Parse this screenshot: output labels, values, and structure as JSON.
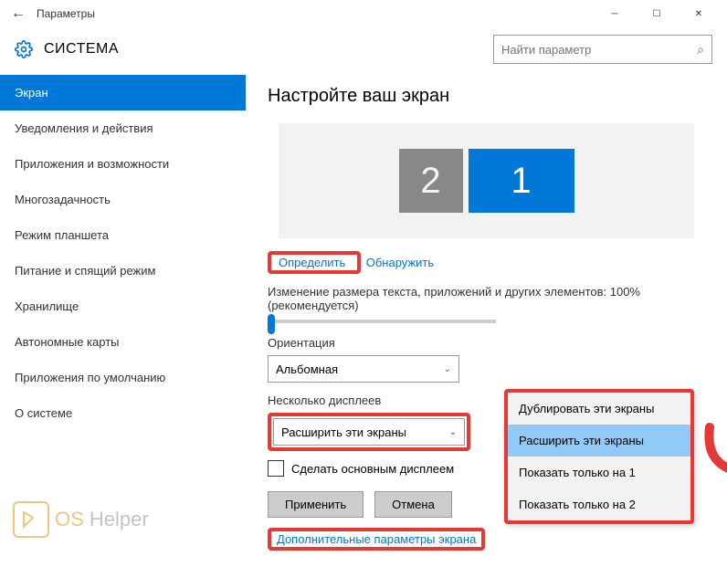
{
  "titlebar": {
    "title": "Параметры"
  },
  "header": {
    "title": "СИСТЕМА",
    "search_placeholder": "Найти параметр"
  },
  "sidebar": {
    "items": [
      {
        "label": "Экран",
        "active": true
      },
      {
        "label": "Уведомления и действия"
      },
      {
        "label": "Приложения и возможности"
      },
      {
        "label": "Многозадачность"
      },
      {
        "label": "Режим планшета"
      },
      {
        "label": "Питание и спящий режим"
      },
      {
        "label": "Хранилище"
      },
      {
        "label": "Автономные карты"
      },
      {
        "label": "Приложения по умолчанию"
      },
      {
        "label": "О системе"
      }
    ]
  },
  "main": {
    "page_title": "Настройте ваш экран",
    "display_2": "2",
    "display_1": "1",
    "identify_btn": "Определить",
    "detect_btn": "Обнаружить",
    "scale_label": "Изменение размера текста, приложений и других элементов: 100% (рекомендуется)",
    "orientation_label": "Ориентация",
    "orientation_value": "Альбомная",
    "multi_display_label": "Несколько дисплеев",
    "multi_display_value": "Расширить эти экраны",
    "make_main_label": "Сделать основным дисплеем",
    "apply_btn": "Применить",
    "cancel_btn": "Отмена",
    "advanced_link": "Дополнительные параметры экрана"
  },
  "dropdown": {
    "items": [
      {
        "label": "Дублировать эти экраны"
      },
      {
        "label": "Расширить эти экраны",
        "selected": true
      },
      {
        "label": "Показать только на 1"
      },
      {
        "label": "Показать только на 2"
      }
    ]
  },
  "watermark": {
    "os": "OS",
    "helper": " Helper"
  }
}
